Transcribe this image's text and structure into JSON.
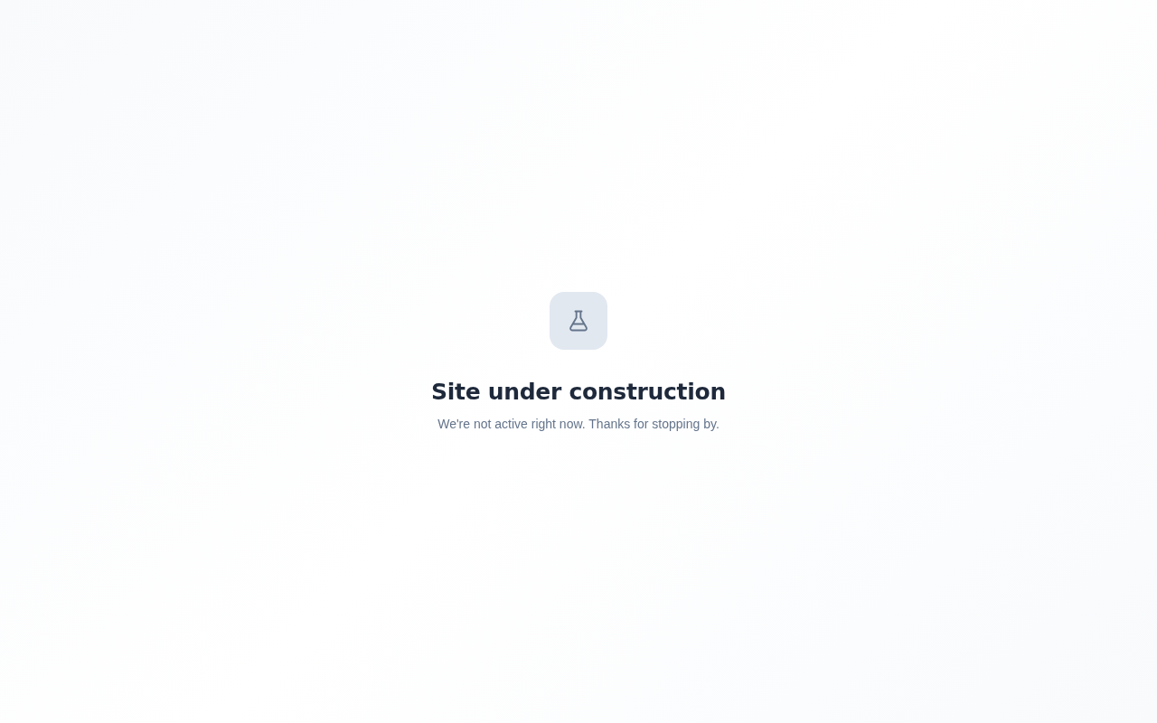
{
  "title": "Site under construction",
  "message": "We're not active right now. Thanks for stopping by."
}
